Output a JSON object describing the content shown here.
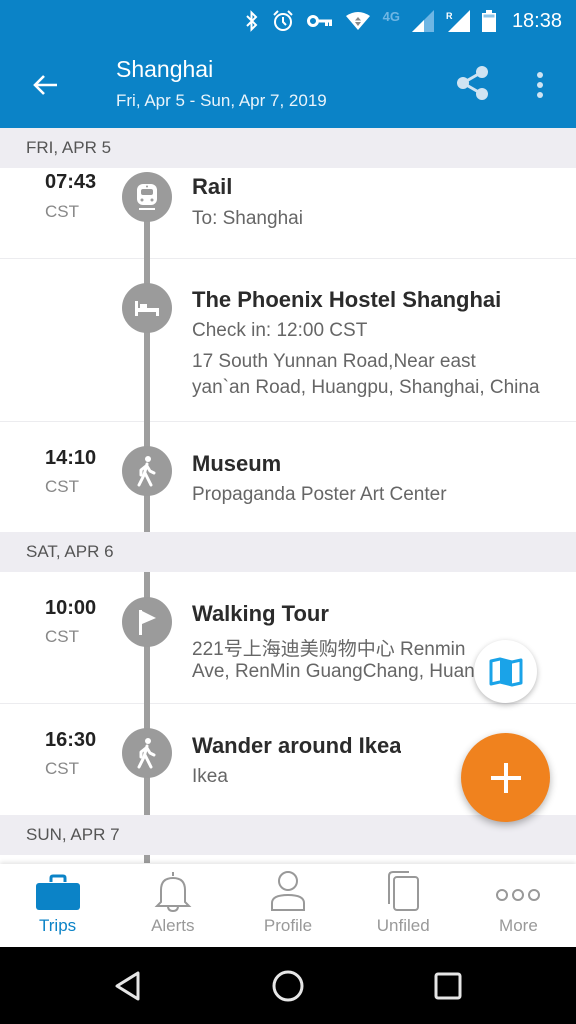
{
  "status_bar": {
    "time": "18:38",
    "network": "4G",
    "icons": [
      "bluetooth-icon",
      "alarm-icon",
      "vpn-key-icon",
      "wifi-icon",
      "signal-icon",
      "roaming-signal-icon",
      "battery-icon"
    ]
  },
  "app_bar": {
    "title": "Shanghai",
    "subtitle": "Fri, Apr 5 - Sun, Apr 7, 2019",
    "back_icon": "arrow-left-icon",
    "share_icon": "share-icon",
    "more_icon": "more-vert-icon"
  },
  "days": [
    {
      "header": "FRI, APR 5",
      "items": [
        {
          "time": "07:43",
          "tz": "CST",
          "icon": "train-icon",
          "title": "Rail",
          "lines": [
            "To: Shanghai"
          ]
        },
        {
          "time": "",
          "tz": "",
          "icon": "bed-icon",
          "title": "The Phoenix Hostel Shanghai",
          "lines": [
            "Check in: 12:00 CST",
            "17 South Yunnan Road,Near east",
            "yan`an Road, Huangpu, Shanghai, China"
          ]
        },
        {
          "time": "14:10",
          "tz": "CST",
          "icon": "walk-icon",
          "title": "Museum",
          "lines": [
            "Propaganda Poster Art Center"
          ]
        }
      ]
    },
    {
      "header": "SAT, APR 6",
      "items": [
        {
          "time": "10:00",
          "tz": "CST",
          "icon": "flag-icon",
          "title": "Walking Tour",
          "lines": [
            "221号上海迪美购物中心 Renmin",
            "Ave, RenMin GuangChang, Huangpu"
          ]
        },
        {
          "time": "16:30",
          "tz": "CST",
          "icon": "walk-icon",
          "title": "Wander around Ikea",
          "lines": [
            "Ikea"
          ]
        }
      ]
    },
    {
      "header": "SUN, APR 7",
      "items": []
    }
  ],
  "fabs": {
    "map_icon": "map-icon",
    "add_icon": "plus-icon"
  },
  "bottom_nav": [
    {
      "label": "Trips",
      "icon": "briefcase-icon",
      "active": true
    },
    {
      "label": "Alerts",
      "icon": "bell-icon",
      "active": false
    },
    {
      "label": "Profile",
      "icon": "person-icon",
      "active": false
    },
    {
      "label": "Unfiled",
      "icon": "documents-icon",
      "active": false
    },
    {
      "label": "More",
      "icon": "more-horiz-icon",
      "active": false
    }
  ],
  "colors": {
    "primary": "#0b83c7",
    "accent": "#f0821e",
    "timeline": "#9e9e9e",
    "day_header_bg": "#eeedf2"
  }
}
